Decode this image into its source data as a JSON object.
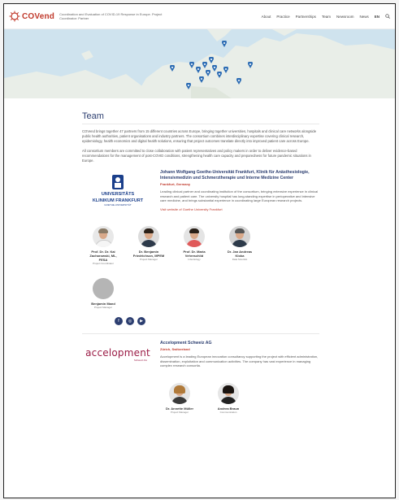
{
  "header": {
    "logo_text": "COVend",
    "tagline": "Coordination and Evaluation of COVID-19 Response in Europe. Project Coordinator: Partner",
    "nav": [
      "About",
      "Practice",
      "Partnerships",
      "Team",
      "Newsroom",
      "News",
      "EN"
    ]
  },
  "team": {
    "title": "Team",
    "paragraph1": "COVend brings together 47 partners from 15 different countries across Europe, bringing together universities, hospitals and clinical care networks alongside public health authorities, patient organisations and industry partners. The consortium combines interdisciplinary expertise covering clinical research, epidemiology, health economics and digital health solutions, ensuring that project outcomes translate directly into improved patient care across Europe.",
    "paragraph2": "All consortium members are committed to close collaboration with patient representatives and policy makers in order to deliver evidence-based recommendations for the management of post-COVID conditions, strengthening health care capacity and preparedness for future pandemic situations in Europe."
  },
  "partner1": {
    "logo_line1": "UNIVERSITÄTS",
    "logo_line2": "KLINIKUM FRANKFURT",
    "logo_sub": "GOETHE-UNIVERSITÄT",
    "name": "Johann Wolfgang Goethe-Universität Frankfurt, Klinik für Anästhesiologie, Intensivmedizin und Schmerztherapie und Interne Medizine Center",
    "location": "Frankfurt, Germany",
    "text": "Leading clinical partner and coordinating institution of the consortium, bringing extensive experience in clinical research and patient care. The university hospital has long-standing expertise in perioperative and intensive care medicine, and brings substantial experience in coordinating large European research projects.",
    "link": "Visit website of Goethe University Frankfurt"
  },
  "people1": [
    {
      "name": "Prof. Dr. Dr. Kai Zacharowski, ML, FESA",
      "role": "Project Coordinator"
    },
    {
      "name": "Dr. Benjamin Friedrichson, MPEM",
      "role": "Project Manager"
    },
    {
      "name": "Prof. Dr. Maria Vehreschild",
      "role": "Infectiology"
    },
    {
      "name": "Dr. Jan Andreas Kloka",
      "role": "Data Scientist"
    },
    {
      "name": "Benjamin Mand",
      "role": "Project Manager"
    }
  ],
  "partner2": {
    "logo": "accelopment",
    "logo_sub": "Schweiz AG",
    "name": "Accelopment Schweiz AG",
    "location": "Zürich, Switzerland",
    "text": "Accelopment is a leading European innovation consultancy supporting the project with efficient administration, dissemination, exploitation and communication activities. The company has vast experience in managing complex research consortia."
  },
  "people2": [
    {
      "name": "Dr. Annette Müller",
      "role": "Project Manager"
    },
    {
      "name": "Andrea Braun",
      "role": "Communication"
    }
  ],
  "colors": {
    "brand": "#c0392b",
    "navy": "#2c3e70",
    "accelopment": "#9b1c46"
  }
}
